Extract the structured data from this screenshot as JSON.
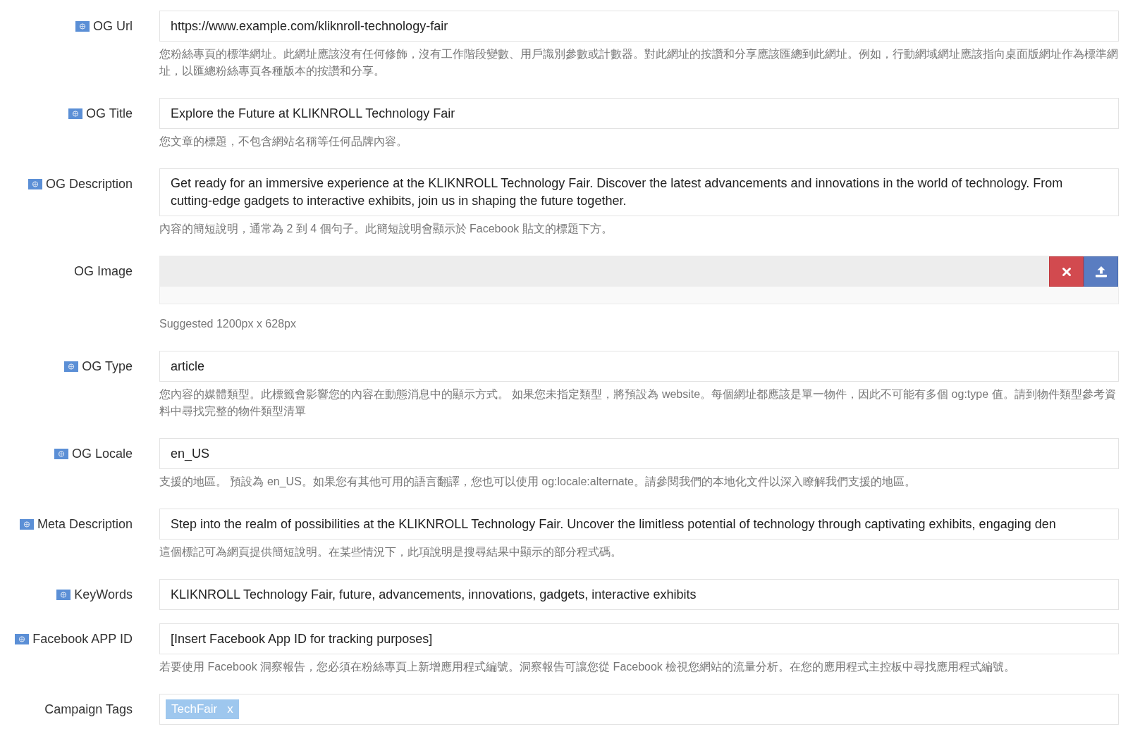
{
  "fields": [
    {
      "kind": "text",
      "label": "OG Url",
      "flag": true,
      "value": "https://www.example.com/kliknroll-technology-fair",
      "help": "您粉絲專頁的標準網址。此網址應該沒有任何修飾，沒有工作階段變數、用戶識別參數或計數器。對此網址的按讚和分享應該匯總到此網址。例如，行動網域網址應該指向桌面版網址作為標準網址，以匯總粉絲專頁各種版本的按讚和分享。"
    },
    {
      "kind": "text",
      "label": "OG Title",
      "flag": true,
      "value": "Explore the Future at KLIKNROLL Technology Fair",
      "help": "您文章的標題，不包含網站名稱等任何品牌內容。"
    },
    {
      "kind": "textarea",
      "label": "OG Description",
      "flag": true,
      "value": "Get ready for an immersive experience at the KLIKNROLL Technology Fair. Discover the latest advancements and innovations in the world of technology. From cutting-edge gadgets to interactive exhibits, join us in shaping the future together.",
      "help": "內容的簡短說明，通常為 2 到 4 個句子。此簡短說明會顯示於 Facebook 貼文的標題下方。"
    },
    {
      "kind": "image",
      "label": "OG Image",
      "flag": false,
      "help": "Suggested 1200px x 628px"
    },
    {
      "kind": "text",
      "label": "OG Type",
      "flag": true,
      "value": "article",
      "help": "您內容的媒體類型。此標籤會影響您的內容在動態消息中的顯示方式。 如果您未指定類型，將預設為 website。每個網址都應該是單一物件，因此不可能有多個 og:type 值。請到物件類型參考資料中尋找完整的物件類型清單"
    },
    {
      "kind": "text",
      "label": "OG Locale",
      "flag": true,
      "value": "en_US",
      "help": "支援的地區。 預設為 en_US。如果您有其他可用的語言翻譯，您也可以使用 og:locale:alternate。請參閱我們的本地化文件以深入瞭解我們支援的地區。"
    },
    {
      "kind": "text",
      "label": "Meta Description",
      "flag": true,
      "value": "Step into the realm of possibilities at the KLIKNROLL Technology Fair. Uncover the limitless potential of technology through captivating exhibits, engaging den",
      "help": "這個標記可為網頁提供簡短說明。在某些情況下，此項說明是搜尋結果中顯示的部分程式碼。"
    },
    {
      "kind": "text",
      "label": "KeyWords",
      "flag": true,
      "value": "KLIKNROLL Technology Fair, future, advancements, innovations, gadgets, interactive exhibits"
    },
    {
      "kind": "text",
      "label": "Facebook APP ID",
      "flag": true,
      "value": "[Insert Facebook App ID for tracking purposes]",
      "help": "若要使用 Facebook 洞察報告，您必須在粉絲專頁上新增應用程式編號。洞察報告可讓您從 Facebook 檢視您網站的流量分析。在您的應用程式主控板中尋找應用程式編號。"
    },
    {
      "kind": "tags",
      "label": "Campaign Tags",
      "flag": false,
      "tags": [
        {
          "text": "TechFair",
          "remove": "x"
        }
      ]
    }
  ]
}
